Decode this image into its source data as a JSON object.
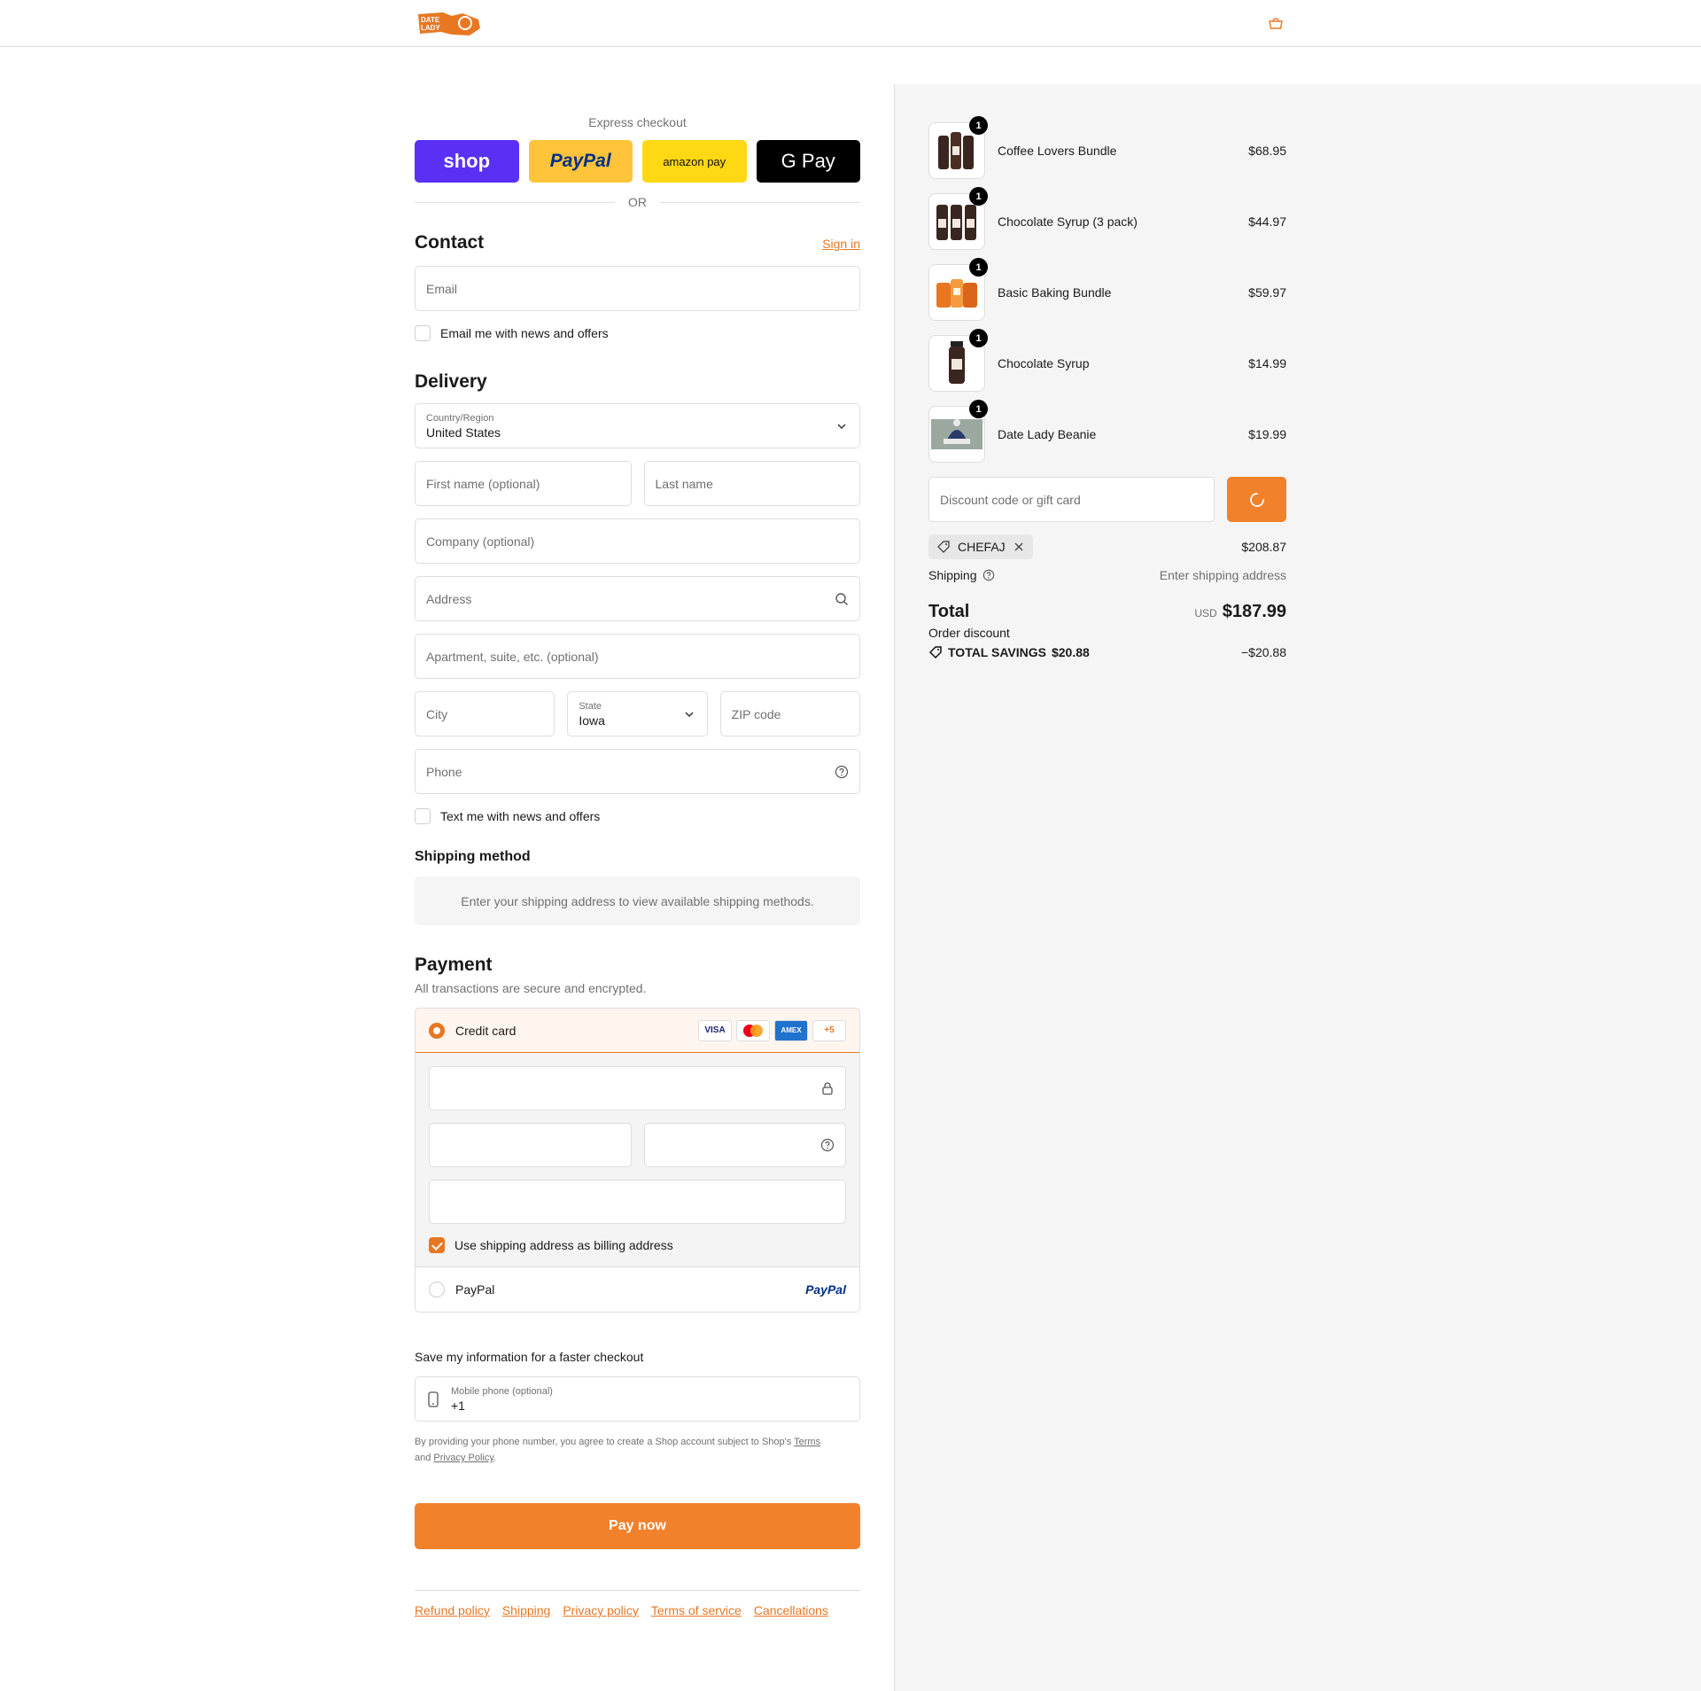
{
  "header": {
    "logo_text": "DATE LADY"
  },
  "express": {
    "title": "Express checkout",
    "shop_label": "shop",
    "paypal_label": "PayPal",
    "amazon_label": "amazon pay",
    "gpay_label": "G Pay",
    "or_label": "OR"
  },
  "contact": {
    "title": "Contact",
    "sign_in": "Sign in",
    "email_placeholder": "Email",
    "news_label": "Email me with news and offers"
  },
  "delivery": {
    "title": "Delivery",
    "country_label": "Country/Region",
    "country_value": "United States",
    "first_name": "First name (optional)",
    "last_name": "Last name",
    "company": "Company (optional)",
    "address": "Address",
    "apartment": "Apartment, suite, etc. (optional)",
    "city": "City",
    "state_label": "State",
    "state_value": "Iowa",
    "zip": "ZIP code",
    "phone": "Phone",
    "text_label": "Text me with news and offers"
  },
  "shipping_method": {
    "title": "Shipping method",
    "message": "Enter your shipping address to view available shipping methods."
  },
  "payment": {
    "title": "Payment",
    "subtitle": "All transactions are secure and encrypted.",
    "credit_card": "Credit card",
    "card_brands": [
      "VISA",
      "MC",
      "AMEX",
      "+5"
    ],
    "billing_label": "Use shipping address as billing address",
    "paypal": "PayPal",
    "paypal_logo": "PayPal"
  },
  "save": {
    "title": "Save my information for a faster checkout",
    "phone_label": "Mobile phone (optional)",
    "phone_value": "+1",
    "legal_pre": "By providing your phone number, you agree to create a Shop account subject to Shop's",
    "terms": "Terms",
    "and": "and",
    "privacy": "Privacy Policy",
    "period": "."
  },
  "pay_now": "Pay now",
  "footer": [
    "Refund policy",
    "Shipping",
    "Privacy policy",
    "Terms of service",
    "Cancellations"
  ],
  "summary": {
    "items": [
      {
        "name": "Coffee Lovers Bundle",
        "price": "$68.95",
        "qty": "1"
      },
      {
        "name": "Chocolate Syrup (3 pack)",
        "price": "$44.97",
        "qty": "1"
      },
      {
        "name": "Basic Baking Bundle",
        "price": "$59.97",
        "qty": "1"
      },
      {
        "name": "Chocolate Syrup",
        "price": "$14.99",
        "qty": "1"
      },
      {
        "name": "Date Lady Beanie",
        "price": "$19.99",
        "qty": "1"
      }
    ],
    "discount_placeholder": "Discount code or gift card",
    "code": "CHEFAJ",
    "subtotal": "$208.87",
    "shipping_label": "Shipping",
    "shipping_value": "Enter shipping address",
    "total_label": "Total",
    "order_discount": "Order discount",
    "currency": "USD",
    "total": "$187.99",
    "savings_label": "TOTAL SAVINGS",
    "savings_value": "$20.88",
    "discount_value": "−$20.88"
  },
  "colors": {
    "accent": "#f2812b",
    "shop": "#5a31f4",
    "paypal": "#ffc439",
    "amazon": "#ffd814"
  }
}
